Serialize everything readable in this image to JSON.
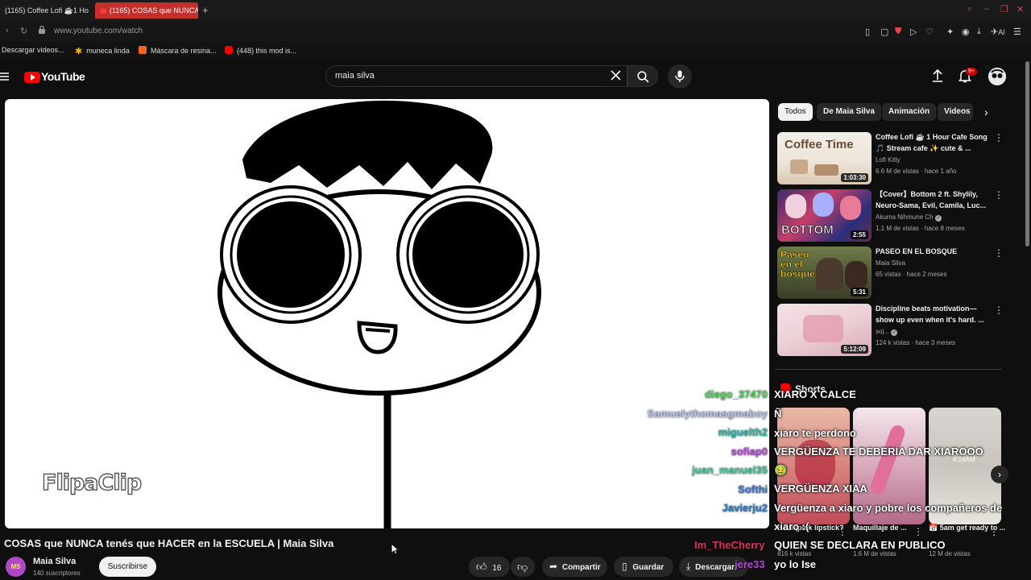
{
  "browser": {
    "tabs": [
      {
        "label": "(1165) Coffee Lofi ☕1 Ho"
      },
      {
        "label": "(1165) COSAS que NUNCA"
      }
    ],
    "add_tab": "+",
    "url": "www.youtube.com/watch",
    "bookmarks": [
      {
        "label": "Descargar videos..."
      },
      {
        "label": "muneca linda"
      },
      {
        "label": "Máscara de resina..."
      },
      {
        "label": "(448) this mod is..."
      }
    ],
    "ext_ai_label": "AI"
  },
  "youtube": {
    "logo_text": "YouTube",
    "search_value": "maia silva",
    "notification_count": "9+",
    "video": {
      "title": "COSAS que NUNCA tenés que HACER en la ESCUELA | Maia Silva",
      "watermark": "FlipaClip",
      "channel_name": "Maia Silva",
      "channel_initials": "MS",
      "subscribers": "140 suscriptores",
      "subscribe_label": "Suscribirse",
      "likes": "16",
      "share_label": "Compartir",
      "save_label": "Guardar",
      "download_label": "Descargar"
    },
    "chips": [
      "Todos",
      "De Maia Silva",
      "Animación",
      "Videos"
    ],
    "recommended": [
      {
        "title": "Coffee Lofi ☕ 1 Hour Cafe Song 🎵 Stream cafe ✨ cute & ...",
        "channel": "Lofi Kitty",
        "meta": "6.6 M de vistas · hace 1 año",
        "duration": "1:03:30",
        "thumb_text": "Coffee Time"
      },
      {
        "title": "【Cover】Bottom 2 ft. Shylily, Neuro-Sama, Evil, Camila, Luc...",
        "channel": "Akuma Nihmune Ch",
        "meta": "1.1 M de vistas · hace 8 meses",
        "duration": "2:55",
        "thumb_text": "BOTTOM"
      },
      {
        "title": "PASEO EN EL BOSQUE",
        "channel": "Maia Silva",
        "meta": "65 vistas · hace 2 meses",
        "duration": "5:31",
        "thumb_text": "Paseo en el bosque"
      },
      {
        "title": "Discipline beats motivation— show up even when it's hard. ...",
        "channel": "soj...",
        "meta": "124 k vistas · hace 3 meses",
        "duration": "5:12:09",
        "thumb_text": ""
      }
    ],
    "shorts_heading": "Shorts",
    "shorts": [
      {
        "title": "Haul (pink lipstick?",
        "views": "816 k vistas"
      },
      {
        "title": "Maquillaje de ...",
        "views": "1.6 M de vistas"
      },
      {
        "title": "📅 5am get ready to ...",
        "views": "12 M de vistas"
      }
    ],
    "short3_overlay": "4:14AM"
  },
  "chat_overlay": {
    "usernames": [
      {
        "name": "diego_37470",
        "color": "#4fd65a"
      },
      {
        "name": "Samuelythomasgmaboy",
        "color": "#b8c4ee"
      },
      {
        "name": "miguelth2",
        "color": "#2fb9a6"
      },
      {
        "name": "sofiap0",
        "color": "#b54ad8"
      },
      {
        "name": "juan_manuel35",
        "color": "#3ecf9c"
      },
      {
        "name": "Softhi",
        "color": "#3a7bd9"
      },
      {
        "name": "Javierju2",
        "color": "#2f7fc7"
      },
      {
        "name": "Im_TheCherry",
        "color": "#e0305a"
      },
      {
        "name": "jere33",
        "color": "#b54ad8"
      }
    ],
    "messages": [
      "XIARO X CALCE",
      "Ñ",
      "xiaro te perdono",
      "VERGÜENZA TE DEBERÍA DAR XIAROOO",
      "🤢",
      "VERGÜENZA XIAA",
      "Vergüenza a xiaro y pobre los compañeros de",
      "xiaro :(",
      "QUIEN SE DECLARA EN PUBLICO",
      "yo lo Ise"
    ]
  }
}
